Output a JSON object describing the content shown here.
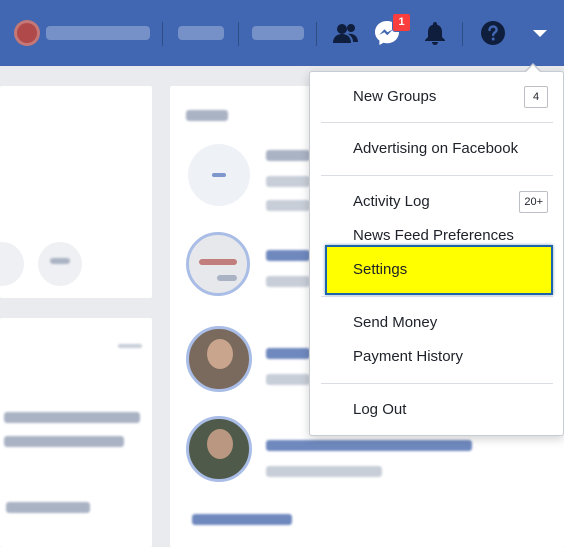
{
  "topbar": {
    "background": "#4267b2",
    "notification_count": "1",
    "icons": [
      "friends-icon",
      "messenger-icon",
      "notifications-icon",
      "help-icon",
      "caret-down-icon"
    ]
  },
  "dropdown": {
    "highlight_color": "#ffff00",
    "highlight_border": "#1f64a8",
    "items": [
      {
        "label": "New Groups",
        "count": "4"
      },
      {
        "label": "Advertising on Facebook"
      },
      {
        "label": "Activity Log",
        "count": "20+"
      },
      {
        "label": "News Feed Preferences"
      },
      {
        "label": "Settings",
        "highlighted": true
      },
      {
        "label": "Send Money"
      },
      {
        "label": "Payment History"
      },
      {
        "label": "Log Out"
      }
    ]
  }
}
